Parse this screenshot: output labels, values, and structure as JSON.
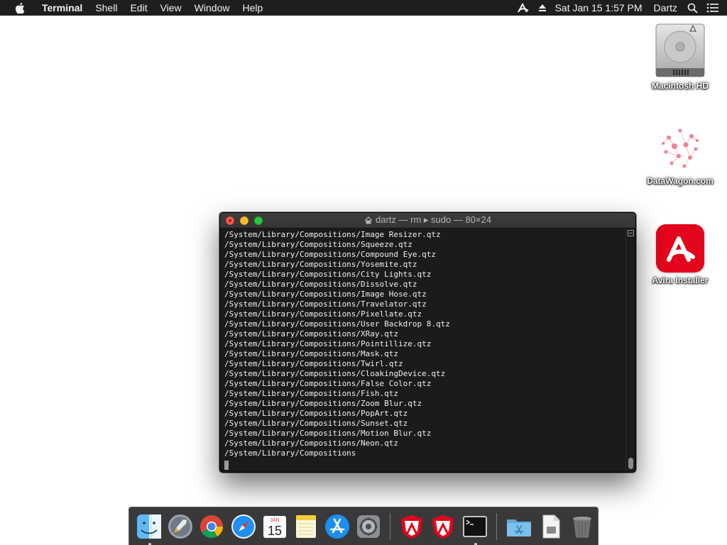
{
  "menubar": {
    "app_name": "Terminal",
    "menus": [
      "Shell",
      "Edit",
      "View",
      "Window",
      "Help"
    ],
    "clock": "Sat Jan 15  1:57 PM",
    "user": "Dartz"
  },
  "desktop": {
    "icons": [
      {
        "label": "Macintosh HD",
        "icon": "hard-drive-icon"
      },
      {
        "label": "DataWagon.com",
        "icon": "datawagon-icon"
      },
      {
        "label": "Avira Installer",
        "icon": "avira-icon"
      }
    ]
  },
  "terminal": {
    "title": "dartz — rm ▸ sudo — 80×24",
    "lines": [
      "/System/Library/Compositions/Image Resizer.qtz",
      "/System/Library/Compositions/Squeeze.qtz",
      "/System/Library/Compositions/Compound Eye.qtz",
      "/System/Library/Compositions/Yosemite.qtz",
      "/System/Library/Compositions/City Lights.qtz",
      "/System/Library/Compositions/Dissolve.qtz",
      "/System/Library/Compositions/Image Hose.qtz",
      "/System/Library/Compositions/Travelator.qtz",
      "/System/Library/Compositions/Pixellate.qtz",
      "/System/Library/Compositions/User Backdrop 8.qtz",
      "/System/Library/Compositions/XRay.qtz",
      "/System/Library/Compositions/Pointillize.qtz",
      "/System/Library/Compositions/Mask.qtz",
      "/System/Library/Compositions/Twirl.qtz",
      "/System/Library/Compositions/CloakingDevice.qtz",
      "/System/Library/Compositions/False Color.qtz",
      "/System/Library/Compositions/Fish.qtz",
      "/System/Library/Compositions/Zoom Blur.qtz",
      "/System/Library/Compositions/PopArt.qtz",
      "/System/Library/Compositions/Sunset.qtz",
      "/System/Library/Compositions/Motion Blur.qtz",
      "/System/Library/Compositions/Neon.qtz",
      "/System/Library/Compositions"
    ]
  },
  "dock": {
    "calendar_month": "JAN",
    "calendar_day": "15",
    "items": [
      "finder-icon",
      "launchpad-icon",
      "chrome-icon",
      "safari-icon",
      "calendar-icon",
      "notes-icon",
      "app-store-icon",
      "system-preferences-icon",
      "avira-shield-icon",
      "avira-shield-icon",
      "terminal-icon",
      "applications-folder-icon",
      "document-icon",
      "trash-icon"
    ]
  }
}
